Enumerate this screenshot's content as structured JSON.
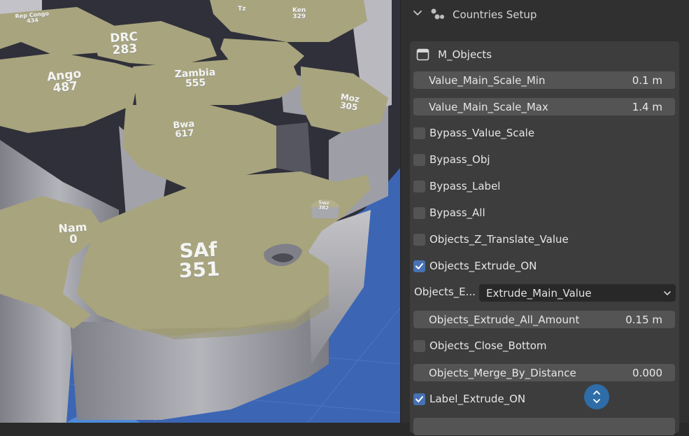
{
  "viewport": {
    "labels": [
      {
        "id": "rep-congo",
        "text": "Rep Congo\n434"
      },
      {
        "id": "drc",
        "text": "DRC\n283"
      },
      {
        "id": "ango",
        "text": "Ango\n487"
      },
      {
        "id": "zambia",
        "text": "Zambia\n555"
      },
      {
        "id": "moz",
        "text": "Moz\n305"
      },
      {
        "id": "bwa",
        "text": "Bwa\n617"
      },
      {
        "id": "swz",
        "text": "Swz\n382"
      },
      {
        "id": "nam",
        "text": "Nam\n0"
      },
      {
        "id": "saf",
        "text": "SAf\n351"
      },
      {
        "id": "ken",
        "text": "Ken\n329"
      },
      {
        "id": "tz",
        "text": "Tz"
      }
    ]
  },
  "panel": {
    "title": "Countries Setup",
    "subpanel": {
      "title": "M_Objects",
      "fields": {
        "value_main_scale_min": {
          "label": "Value_Main_Scale_Min",
          "value": "0.1 m"
        },
        "value_main_scale_max": {
          "label": "Value_Main_Scale_Max",
          "value": "1.4 m"
        },
        "objects_extrude_all_amount": {
          "label": "Objects_Extrude_All_Amount",
          "value": "0.15 m"
        },
        "objects_merge_by_distance": {
          "label": "Objects_Merge_By_Distance",
          "value": "0.000"
        }
      },
      "checkboxes": {
        "bypass_value_scale": {
          "label": "Bypass_Value_Scale",
          "checked": false
        },
        "bypass_obj": {
          "label": "Bypass_Obj",
          "checked": false
        },
        "bypass_label": {
          "label": "Bypass_Label",
          "checked": false
        },
        "bypass_all": {
          "label": "Bypass_All",
          "checked": false
        },
        "objects_z_translate_value": {
          "label": "Objects_Z_Translate_Value",
          "checked": false
        },
        "objects_extrude_on": {
          "label": "Objects_Extrude_ON",
          "checked": true
        },
        "objects_close_bottom": {
          "label": "Objects_Close_Bottom",
          "checked": false
        },
        "label_extrude_on": {
          "label": "Label_Extrude_ON",
          "checked": true
        }
      },
      "enum": {
        "label": "Objects_E...",
        "value": "Extrude_Main_Value"
      }
    }
  },
  "colors": {
    "accent": "#4772b3",
    "field_bg": "#545454",
    "panel_bg": "#303030",
    "subpanel_bg": "#3d3d3d",
    "land_top": "#a8a47e",
    "land_side": "#8e8f96",
    "sea": "#3c66b4"
  }
}
